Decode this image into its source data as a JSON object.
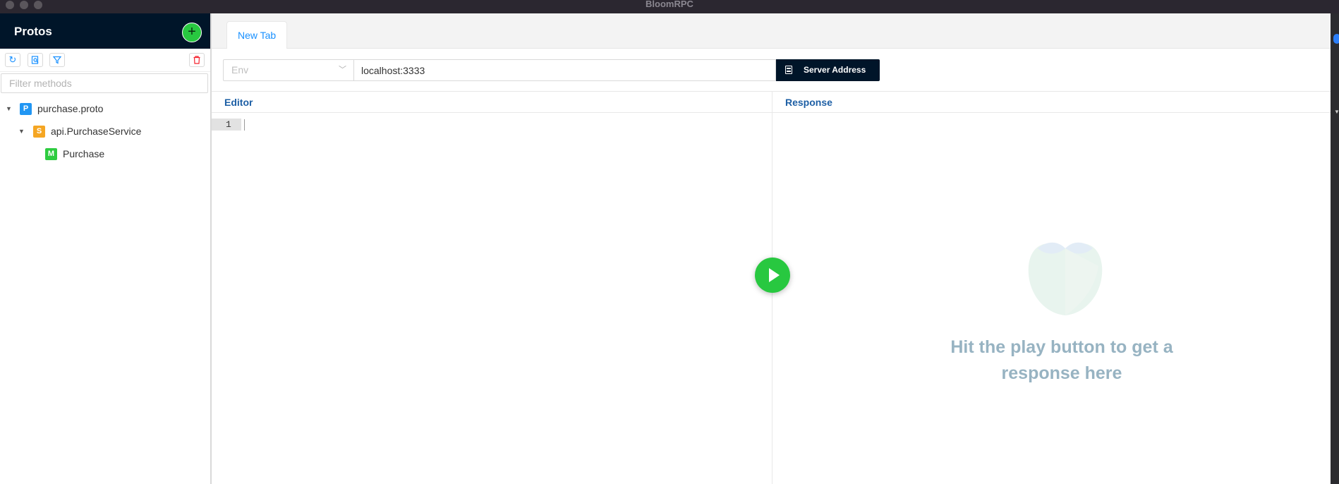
{
  "window": {
    "title": "BloomRPC"
  },
  "sidebar": {
    "title": "Protos",
    "filter_placeholder": "Filter methods",
    "tree": [
      {
        "badge": "P",
        "label": "purchase.proto",
        "color": "#2196f3"
      },
      {
        "badge": "S",
        "label": "api.PurchaseService",
        "color": "#f5a623"
      },
      {
        "badge": "M",
        "label": "Purchase",
        "color": "#2ecc40"
      }
    ],
    "tools": [
      "reload-icon",
      "import-path-icon",
      "filter-icon",
      "delete-icon"
    ]
  },
  "tabs": [
    {
      "label": "New Tab"
    }
  ],
  "address_bar": {
    "env_placeholder": "Env",
    "server_address": "localhost:3333",
    "button_label": "Server Address"
  },
  "editor": {
    "heading": "Editor",
    "line_number": "1"
  },
  "response": {
    "heading": "Response",
    "empty_message": "Hit the play button to get a response here"
  },
  "colors": {
    "accent": "#1890ff",
    "nav_dark": "#001529",
    "play": "#28c840"
  }
}
